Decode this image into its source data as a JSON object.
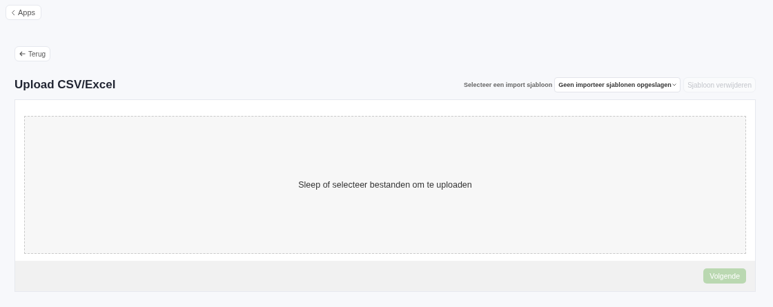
{
  "top_nav": {
    "back_to_apps": "Apps"
  },
  "back_button": {
    "label": "Terug"
  },
  "header": {
    "title": "Upload CSV/Excel",
    "template_label": "Selecteer een import sjabloon",
    "template_select": {
      "value": "Geen importeer sjablonen opgeslagen"
    },
    "delete_button": {
      "label": "Sjabloon verwijderen",
      "disabled": true
    }
  },
  "dropzone": {
    "text": "Sleep of selecteer bestanden om te uploaden"
  },
  "footer": {
    "next_button": {
      "label": "Volgende",
      "disabled": true
    }
  }
}
